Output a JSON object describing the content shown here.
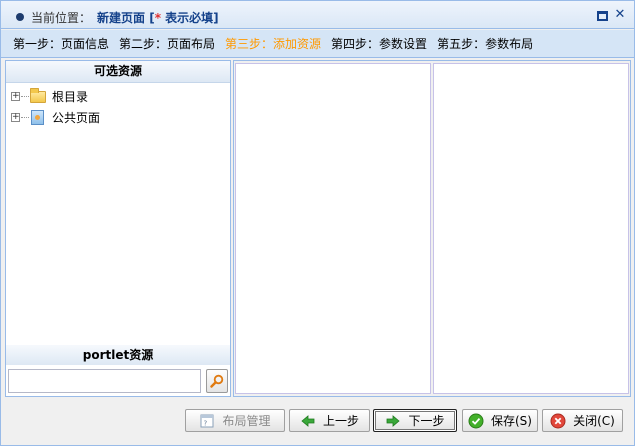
{
  "titlebar": {
    "prefix": "当前位置：",
    "title": "新建页面",
    "required_note_open": " [",
    "required_star": "*",
    "required_note_text": " 表示必填]"
  },
  "steps": [
    {
      "label": "第一步：页面信息",
      "active": false
    },
    {
      "label": "第二步：页面布局",
      "active": false
    },
    {
      "label": "第三步：添加资源",
      "active": true
    },
    {
      "label": "第四步：参数设置",
      "active": false
    },
    {
      "label": "第五步：参数布局",
      "active": false
    }
  ],
  "left_panel": {
    "header": "可选资源",
    "tree": [
      {
        "label": "根目录",
        "icon": "folder-icon",
        "expander": "+"
      },
      {
        "label": "公共页面",
        "icon": "page-icon",
        "expander": "+"
      }
    ],
    "portlet_header": "portlet资源",
    "search": {
      "value": "",
      "placeholder": ""
    }
  },
  "buttons": {
    "layout": "布局管理",
    "prev": "上一步",
    "next": "下一步",
    "save": "保存(S)",
    "close": "关闭(C)"
  },
  "colors": {
    "accent": "#15428b",
    "active_step": "#ff9900",
    "border": "#99bbe8",
    "required": "#e03030"
  }
}
